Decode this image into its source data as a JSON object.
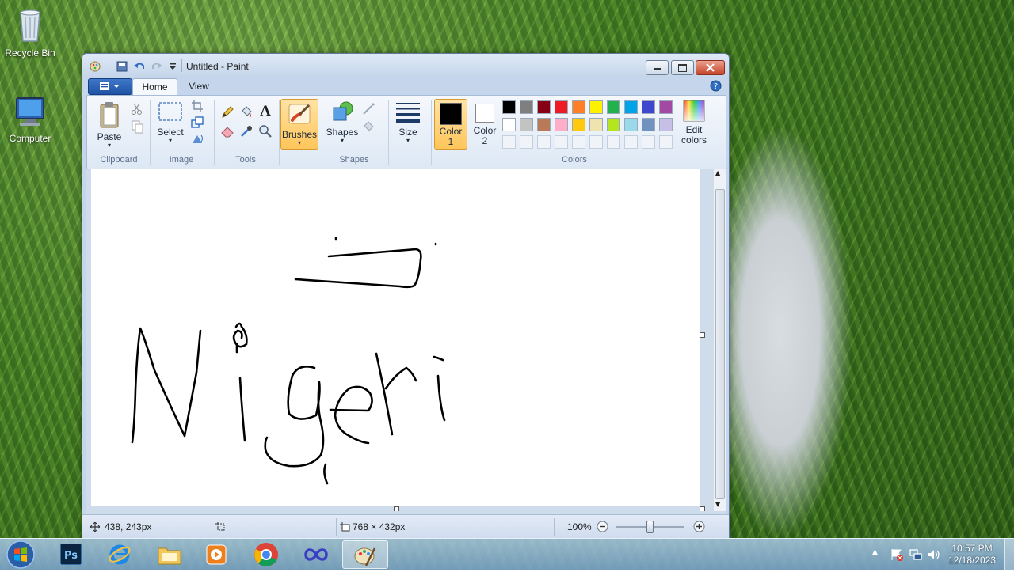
{
  "desktop": {
    "icons": [
      {
        "label": "Recycle Bin",
        "icon": "recycle-bin-icon"
      },
      {
        "label": "Computer",
        "icon": "computer-icon"
      }
    ]
  },
  "window": {
    "title": "Untitled - Paint",
    "tabs": [
      {
        "label": "Home",
        "active": true
      },
      {
        "label": "View",
        "active": false
      }
    ]
  },
  "ribbon": {
    "clipboard": {
      "paste": "Paste",
      "group": "Clipboard"
    },
    "image": {
      "select": "Select",
      "group": "Image"
    },
    "tools": {
      "group": "Tools",
      "text_tool": "A"
    },
    "brushes": {
      "label": "Brushes"
    },
    "shapes": {
      "label": "Shapes",
      "group": "Shapes"
    },
    "size": {
      "label": "Size"
    },
    "color1": {
      "line1": "Color",
      "line2": "1",
      "value": "#000000"
    },
    "color2": {
      "line1": "Color",
      "line2": "2",
      "value": "#ffffff"
    },
    "colors": {
      "group": "Colors",
      "edit_line1": "Edit",
      "edit_line2": "colors",
      "row1": [
        "#000000",
        "#7f7f7f",
        "#880015",
        "#ed1c24",
        "#ff7f27",
        "#fff200",
        "#22b14c",
        "#00a2e8",
        "#3f48cc",
        "#a349a4"
      ],
      "row2": [
        "#ffffff",
        "#c3c3c3",
        "#b97a57",
        "#ffaec9",
        "#ffc90e",
        "#efe4b0",
        "#b5e61d",
        "#99d9ea",
        "#7092be",
        "#c8bfe7"
      ],
      "row3": [
        "#f0f4f9",
        "#f0f4f9",
        "#f0f4f9",
        "#f0f4f9",
        "#f0f4f9",
        "#f0f4f9",
        "#f0f4f9",
        "#f0f4f9",
        "#f0f4f9",
        "#f0f4f9"
      ]
    }
  },
  "status": {
    "cursor_pos": "438, 243px",
    "canvas_size": "768 × 432px",
    "zoom": "100%"
  },
  "taskbar": {
    "items": [
      "start-orb",
      "photoshop-icon",
      "internet-explorer-icon",
      "file-explorer-icon",
      "media-player-icon",
      "chrome-icon",
      "infinity-app-icon",
      "paint-icon"
    ],
    "time": "10:57 PM",
    "date": "12/18/2023"
  }
}
